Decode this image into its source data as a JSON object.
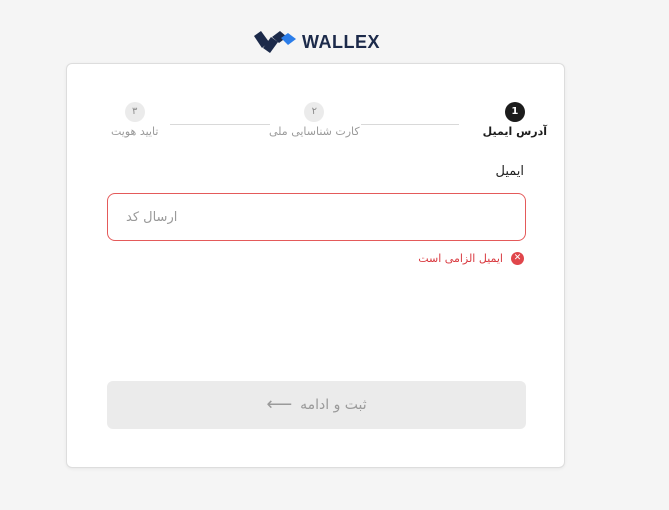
{
  "brand": {
    "name": "WALLEX",
    "logo_icon": "wallex-logo-icon",
    "colors": {
      "dark": "#1c2a4a",
      "accent": "#2b7de9"
    }
  },
  "stepper": {
    "steps": [
      {
        "number": "1",
        "label": "آدرس ایمیل",
        "state": "active"
      },
      {
        "number": "۲",
        "label": "کارت شناسایی ملی",
        "state": "inactive"
      },
      {
        "number": "۳",
        "label": "تایید هویت",
        "state": "inactive"
      }
    ]
  },
  "form": {
    "email_label": "ایمیل",
    "email_placeholder": "ارسال کد",
    "email_value": "",
    "error": {
      "icon": "close-circle-icon",
      "text": "ایمیل الزامی است",
      "color": "#e0464b"
    }
  },
  "submit": {
    "label": "ثبت و ادامه",
    "icon": "arrow-left-icon",
    "enabled": false
  }
}
